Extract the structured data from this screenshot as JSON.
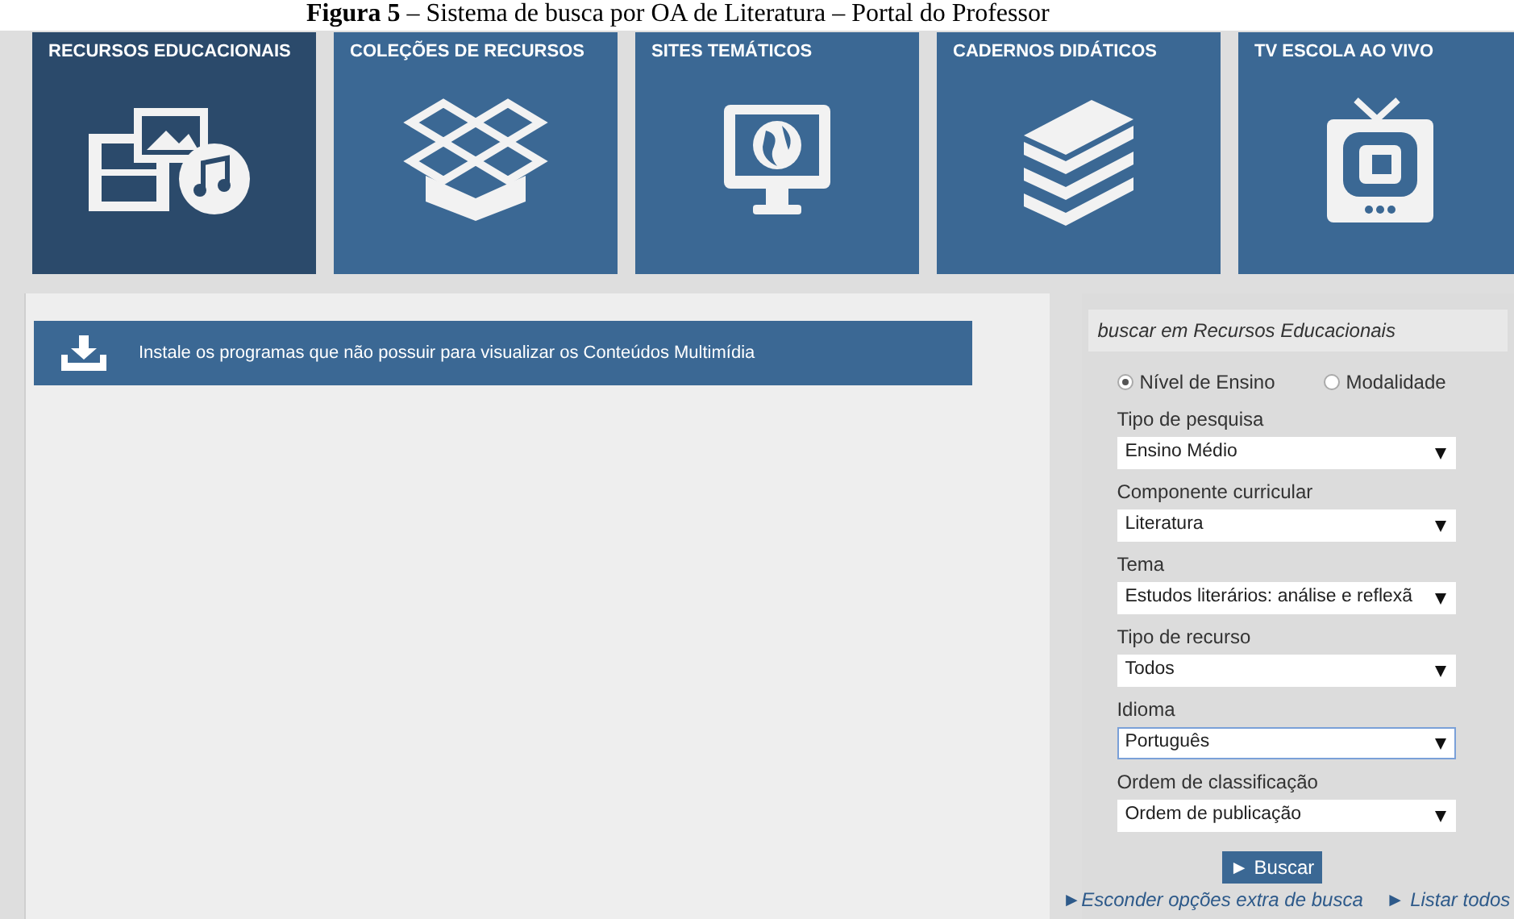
{
  "caption": {
    "label": "Figura 5",
    "text": " – Sistema de busca por OA de Literatura – Portal do Professor"
  },
  "tiles": [
    {
      "label": "RECURSOS EDUCACIONAIS",
      "kind": "media",
      "selected": true
    },
    {
      "label": "COLEÇÕES DE RECURSOS",
      "kind": "box",
      "selected": false
    },
    {
      "label": "SITES TEMÁTICOS",
      "kind": "monitor",
      "selected": false
    },
    {
      "label": "CADERNOS DIDÁTICOS",
      "kind": "books",
      "selected": false
    },
    {
      "label": "TV ESCOLA AO VIVO",
      "kind": "tv",
      "selected": false
    }
  ],
  "banner": {
    "text": "Instale os programas que não possuir para visualizar os Conteúdos Multimídia"
  },
  "search": {
    "heading": "buscar em Recursos Educacionais",
    "radios": [
      {
        "label": "Nível de Ensino",
        "selected": true
      },
      {
        "label": "Modalidade",
        "selected": false
      }
    ],
    "fields": [
      {
        "label": "Tipo de pesquisa",
        "value": "Ensino Médio",
        "focused": false
      },
      {
        "label": "Componente curricular",
        "value": "Literatura",
        "focused": false
      },
      {
        "label": "Tema",
        "value": "Estudos literários: análise e reflexã",
        "focused": false
      },
      {
        "label": "Tipo de recurso",
        "value": "Todos",
        "focused": false
      },
      {
        "label": "Idioma",
        "value": "Português",
        "focused": true
      },
      {
        "label": "Ordem de classificação",
        "value": "Ordem de publicação",
        "focused": false
      }
    ],
    "button": "► Buscar",
    "links": [
      "►Esconder opções extra de busca",
      "► Listar todos"
    ]
  }
}
